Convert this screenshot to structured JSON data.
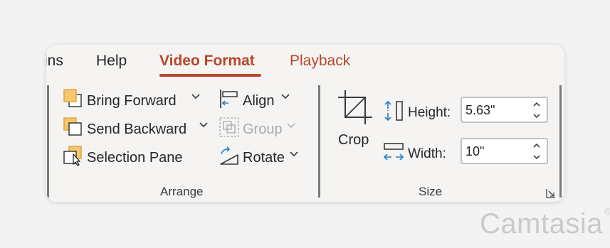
{
  "tabs": [
    {
      "label": "ins"
    },
    {
      "label": "Help"
    },
    {
      "label": "Video Format"
    },
    {
      "label": "Playback"
    }
  ],
  "arrange": {
    "bring_forward": "Bring Forward",
    "send_backward": "Send Backward",
    "selection_pane": "Selection Pane",
    "align": "Align",
    "group": "Group",
    "rotate": "Rotate",
    "group_label": "Arrange"
  },
  "size": {
    "crop": "Crop",
    "height_label": "Height:",
    "height_value": "5.63\"",
    "width_label": "Width:",
    "width_value": "10\"",
    "group_label": "Size"
  },
  "watermark": "Camtasia",
  "colors": {
    "accent": "#b7472a",
    "icon_fill": "#f8c66d",
    "icon_blue": "#1f7fd0"
  }
}
